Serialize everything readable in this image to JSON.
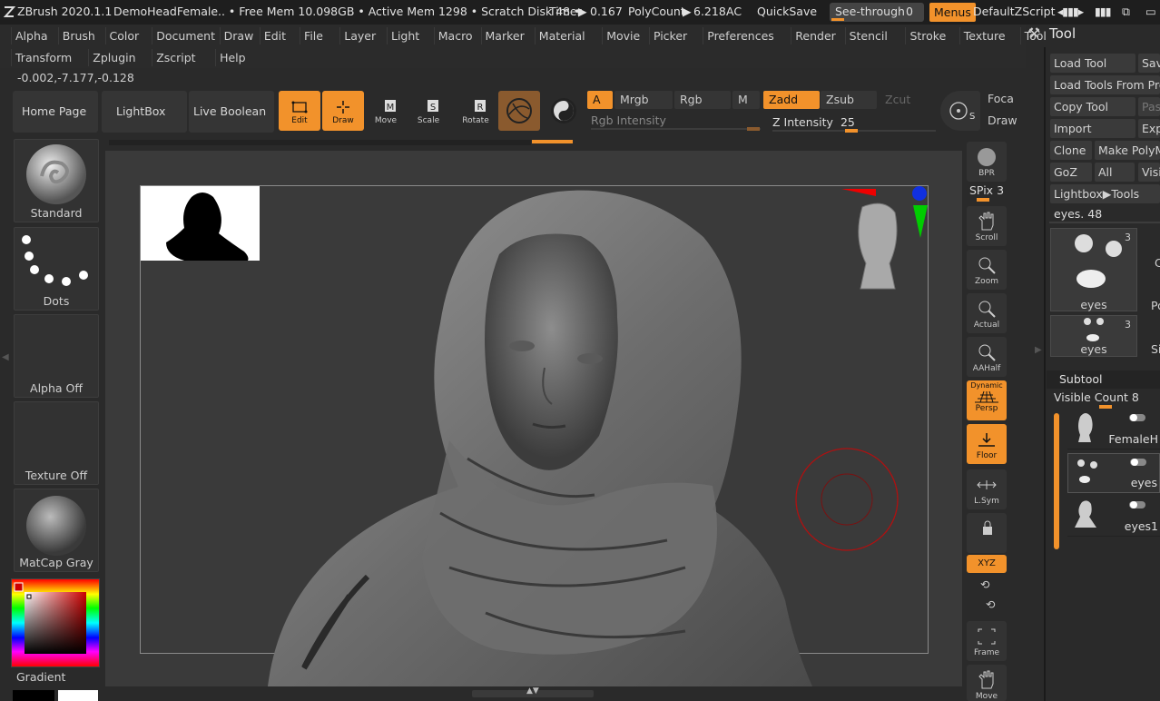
{
  "titlebar": {
    "app": "ZBrush 2020.1.1",
    "document": "DemoHeadFemale",
    "stats": "..  • Free Mem 10.098GB • Active Mem 1298 • Scratch Disk 48 •",
    "timer_label": "Timer",
    "timer_value": "0.167",
    "polycount_label": "PolyCount",
    "polycount_value": "6.218",
    "ac": "AC",
    "quicksave": "QuickSave",
    "seethrough_label": "See-through",
    "seethrough_value": "0",
    "menus": "Menus",
    "zscript": "DefaultZScript"
  },
  "menubar1": [
    "Alpha",
    "Brush",
    "Color",
    "Document",
    "Draw",
    "Edit",
    "File",
    "Layer",
    "Light",
    "Macro",
    "Marker",
    "Material",
    "Movie",
    "Picker",
    "Preferences",
    "Render",
    "Stencil",
    "Stroke",
    "Texture",
    "Tool"
  ],
  "menubar2": [
    "Transform",
    "Zplugin",
    "Zscript",
    "Help"
  ],
  "coords": "-0.002,-7.177,-0.128",
  "shelf": {
    "home": "Home Page",
    "lightbox": "LightBox",
    "liveboolean": "Live Boolean",
    "edit": "Edit",
    "draw": "Draw",
    "move": "Move",
    "scale": "Scale",
    "rotate": "Rotate"
  },
  "channels": {
    "a": "A",
    "mrgb": "Mrgb",
    "rgb": "Rgb",
    "m": "M",
    "zadd": "Zadd",
    "zsub": "Zsub",
    "zcut": "Zcut",
    "rgb_intensity": "Rgb Intensity",
    "z_intensity_label": "Z Intensity",
    "z_intensity_value": "25",
    "z_intensity_level": 0.25,
    "focal": "Foca",
    "draw_size": "Draw"
  },
  "left": {
    "brush": "Standard",
    "stroke": "Dots",
    "alpha": "Alpha Off",
    "texture": "Texture Off",
    "material": "MatCap Gray",
    "gradient": "Gradient"
  },
  "right": {
    "bpr": "BPR",
    "spix_label": "SPix",
    "spix_value": "3",
    "scroll": "Scroll",
    "zoom": "Zoom",
    "actual": "Actual",
    "aahalf": "AAHalf",
    "dynamic": "Dynamic",
    "persp": "Persp",
    "floor": "Floor",
    "lsym": "L.Sym",
    "xyz": "XYZ",
    "frame": "Frame",
    "move": "Move"
  },
  "toolpanel": {
    "title": "Tool",
    "load_tool": "Load Tool",
    "save": "Sav",
    "load_from_project": "Load Tools From Pro",
    "copy_tool": "Copy Tool",
    "paste": "Pas",
    "import": "Import",
    "export": "Exp",
    "clone": "Clone",
    "make_polymesh": "Make PolyM",
    "goz": "GoZ",
    "all": "All",
    "visible": "Visi",
    "lightbox_tools": "Lightbox▶Tools",
    "current_tool": "eyes. 48",
    "thumb1_label": "eyes",
    "thumb1_count": "3",
    "thumb2_label": "eyes",
    "thumb2_count": "3",
    "side_c": "C",
    "side_p": "Po",
    "side_s": "Si",
    "subtool_title": "Subtool",
    "visible_count_label": "Visible Count",
    "visible_count_value": "8",
    "subtools": [
      "FemaleH",
      "eyes",
      "eyes1"
    ]
  },
  "colors": {
    "accent": "#f2922b",
    "background": "#2a2a2a",
    "canvas": "#3a3a3a"
  }
}
